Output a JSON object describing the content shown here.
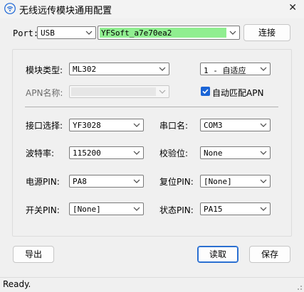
{
  "window": {
    "title": "无线远传模块通用配置"
  },
  "port": {
    "label": "Port:",
    "value": "USB",
    "device": "YFSoft_a7e70ea2",
    "device_bg": "#90ee90",
    "connect_label": "连接"
  },
  "module": {
    "type_label": "模块类型:",
    "type_value": "ML302",
    "mode_value": "1 - 自适应",
    "apn_label": "APN名称:",
    "apn_value": "",
    "auto_apn_label": "自动匹配APN",
    "auto_apn_checked": true
  },
  "settings": {
    "interface_label": "接口选择:",
    "interface_value": "YF3028",
    "serial_label": "串口名:",
    "serial_value": "COM3",
    "baud_label": "波特率:",
    "baud_value": "115200",
    "parity_label": "校验位:",
    "parity_value": "None",
    "power_label": "电源PIN:",
    "power_value": "PA8",
    "reset_label": "复位PIN:",
    "reset_value": "[None]",
    "switch_label": "开关PIN:",
    "switch_value": "[None]",
    "state_label": "状态PIN:",
    "state_value": "PA15"
  },
  "buttons": {
    "export_label": "导出",
    "read_label": "读取",
    "save_label": "保存"
  },
  "status": {
    "text": "Ready."
  },
  "colors": {
    "accent": "#1a64d6",
    "window_bg": "#f0f0f0"
  }
}
